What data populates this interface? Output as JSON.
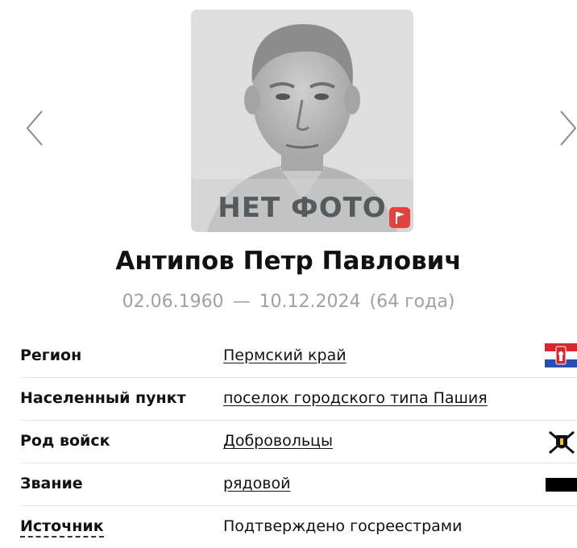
{
  "photo": {
    "placeholder_text": "НЕТ ФОТО"
  },
  "person": {
    "name": "Антипов Петр Павлович",
    "birth": "02.06.1960",
    "separator": "—",
    "death": "10.12.2024",
    "age": "(64 года)"
  },
  "info": [
    {
      "label": "Регион",
      "value": "Пермский край",
      "icon": "region-flag-icon"
    },
    {
      "label": "Населенный пункт",
      "value": "поселок городского типа Пашия"
    },
    {
      "label": "Род войск",
      "value": "Добровольцы",
      "icon": "volunteers-emblem-icon"
    },
    {
      "label": "Звание",
      "value": "рядовой",
      "icon": "rank-badge-icon"
    },
    {
      "label": "Источник",
      "value": "Подтверждено госреестрами"
    }
  ],
  "colors": {
    "flag_button": "#e0443e",
    "dates": "#a0a0a0",
    "photo_bg": "#d9d9d9"
  }
}
